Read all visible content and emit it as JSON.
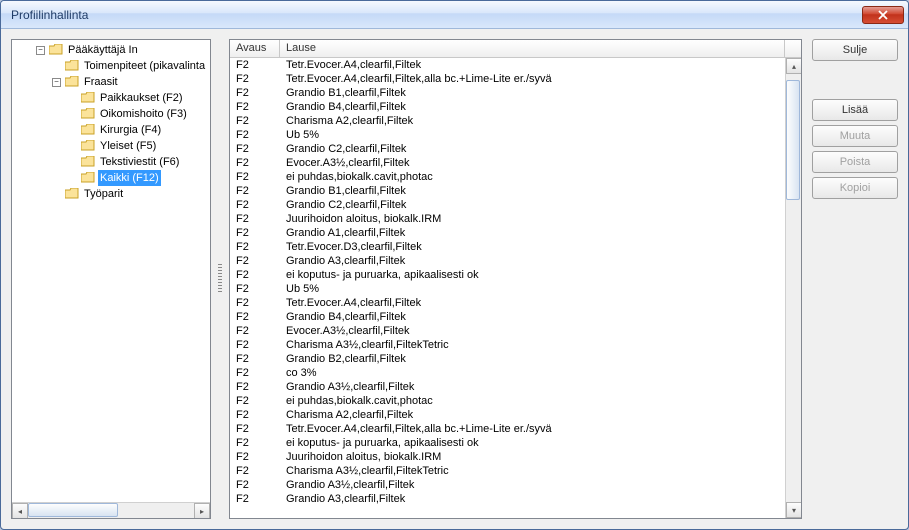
{
  "window": {
    "title": "Profiilinhallinta"
  },
  "tree": {
    "root": {
      "label": "Pääkäyttäjä In",
      "children": [
        {
          "label": "Toimenpiteet (pikavalinta",
          "children": []
        },
        {
          "label": "Fraasit",
          "children": [
            {
              "label": "Paikkaukset  (F2)",
              "selected": false
            },
            {
              "label": "Oikomishoito  (F3)",
              "selected": false
            },
            {
              "label": "Kirurgia  (F4)",
              "selected": false
            },
            {
              "label": "Yleiset  (F5)",
              "selected": false
            },
            {
              "label": "Tekstiviestit  (F6)",
              "selected": false
            },
            {
              "label": "Kaikki  (F12)",
              "selected": true
            }
          ]
        },
        {
          "label": "Työparit",
          "children": []
        }
      ]
    }
  },
  "table": {
    "columns": {
      "avaus": "Avaus",
      "lause": "Lause"
    },
    "rows": [
      {
        "avaus": "F2",
        "lause": "Tetr.Evocer.A4,clearfil,Filtek"
      },
      {
        "avaus": "F2",
        "lause": "Tetr.Evocer.A4,clearfil,Filtek,alla bc.+Lime-Lite er./syvä"
      },
      {
        "avaus": "F2",
        "lause": "Grandio B1,clearfil,Filtek"
      },
      {
        "avaus": "F2",
        "lause": "Grandio B4,clearfil,Filtek"
      },
      {
        "avaus": "F2",
        "lause": "Charisma A2,clearfil,Filtek"
      },
      {
        "avaus": "F2",
        "lause": "Ub 5%"
      },
      {
        "avaus": "F2",
        "lause": "Grandio C2,clearfil,Filtek"
      },
      {
        "avaus": "F2",
        "lause": "Evocer.A3½,clearfil,Filtek"
      },
      {
        "avaus": "F2",
        "lause": "ei puhdas,biokalk.cavit,photac"
      },
      {
        "avaus": "F2",
        "lause": "Grandio B1,clearfil,Filtek"
      },
      {
        "avaus": "F2",
        "lause": "Grandio C2,clearfil,Filtek"
      },
      {
        "avaus": "F2",
        "lause": "Juurihoidon aloitus, biokalk.IRM"
      },
      {
        "avaus": "F2",
        "lause": "Grandio A1,clearfil,Filtek"
      },
      {
        "avaus": "F2",
        "lause": "Tetr.Evocer.D3,clearfil,Filtek"
      },
      {
        "avaus": "F2",
        "lause": "Grandio A3,clearfil,Filtek"
      },
      {
        "avaus": "F2",
        "lause": "ei koputus- ja puruarka, apikaalisesti ok"
      },
      {
        "avaus": "F2",
        "lause": "Ub 5%"
      },
      {
        "avaus": "F2",
        "lause": "Tetr.Evocer.A4,clearfil,Filtek"
      },
      {
        "avaus": "F2",
        "lause": "Grandio B4,clearfil,Filtek"
      },
      {
        "avaus": "F2",
        "lause": "Evocer.A3½,clearfil,Filtek"
      },
      {
        "avaus": "F2",
        "lause": "Charisma A3½,clearfil,FiltekTetric"
      },
      {
        "avaus": "F2",
        "lause": "Grandio B2,clearfil,Filtek"
      },
      {
        "avaus": "F2",
        "lause": "co 3%"
      },
      {
        "avaus": "F2",
        "lause": "Grandio A3½,clearfil,Filtek"
      },
      {
        "avaus": "F2",
        "lause": "ei puhdas,biokalk.cavit,photac"
      },
      {
        "avaus": "F2",
        "lause": "Charisma A2,clearfil,Filtek"
      },
      {
        "avaus": "F2",
        "lause": "Tetr.Evocer.A4,clearfil,Filtek,alla bc.+Lime-Lite er./syvä"
      },
      {
        "avaus": "F2",
        "lause": "ei koputus- ja puruarka, apikaalisesti ok"
      },
      {
        "avaus": "F2",
        "lause": "Juurihoidon aloitus, biokalk.IRM"
      },
      {
        "avaus": "F2",
        "lause": "Charisma A3½,clearfil,FiltekTetric"
      },
      {
        "avaus": "F2",
        "lause": "Grandio A3½,clearfil,Filtek"
      },
      {
        "avaus": "F2",
        "lause": "Grandio A3,clearfil,Filtek"
      }
    ]
  },
  "buttons": {
    "close": "Sulje",
    "add": "Lisää",
    "edit": "Muuta",
    "delete": "Poista",
    "copy": "Kopioi"
  }
}
